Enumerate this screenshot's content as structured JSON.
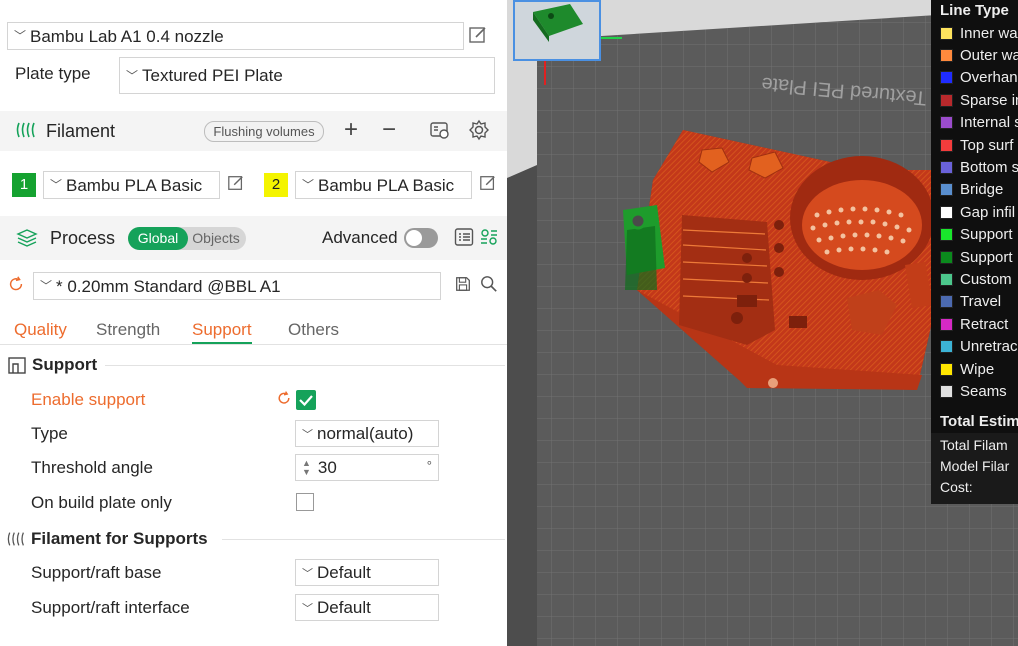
{
  "printer": {
    "name": "Bambu Lab A1 0.4 nozzle"
  },
  "plate": {
    "label": "Plate type",
    "value": "Textured PEI Plate"
  },
  "filament": {
    "title": "Filament",
    "flush_label": "Flushing volumes",
    "items": [
      {
        "index": "1",
        "name": "Bambu PLA Basic",
        "color": "#15a230"
      },
      {
        "index": "2",
        "name": "Bambu PLA Basic",
        "color": "#f4f400"
      }
    ]
  },
  "process": {
    "title": "Process",
    "toggle_global": "Global",
    "toggle_objects": "Objects",
    "advanced_label": "Advanced",
    "preset": "* 0.20mm Standard @BBL A1"
  },
  "tabs": [
    "Quality",
    "Strength",
    "Support",
    "Others"
  ],
  "support": {
    "section_title": "Support",
    "enable_label": "Enable support",
    "type_label": "Type",
    "type_value": "normal(auto)",
    "threshold_label": "Threshold angle",
    "threshold_value": "30",
    "threshold_unit": "°",
    "build_plate_label": "On build plate only"
  },
  "filament_supports": {
    "section_title": "Filament for Supports",
    "base_label": "Support/raft base",
    "base_value": "Default",
    "interface_label": "Support/raft interface",
    "interface_value": "Default"
  },
  "viewport": {
    "plate_text": "Textured PEI Plate"
  },
  "legend": {
    "title": "Line Type",
    "items": [
      {
        "label": "Inner wa",
        "color": "#ffe45e"
      },
      {
        "label": "Outer wa",
        "color": "#ff8a3d"
      },
      {
        "label": "Overhan",
        "color": "#1f2cff"
      },
      {
        "label": "Sparse in",
        "color": "#b8292c"
      },
      {
        "label": "Internal s",
        "color": "#9b4ccc"
      },
      {
        "label": "Top surf",
        "color": "#f33c3c"
      },
      {
        "label": "Bottom s",
        "color": "#6a62d9"
      },
      {
        "label": "Bridge",
        "color": "#5a8fcf"
      },
      {
        "label": "Gap infil",
        "color": "#ffffff"
      },
      {
        "label": "Support",
        "color": "#19e62c"
      },
      {
        "label": "Support",
        "color": "#0b8a1d"
      },
      {
        "label": "Custom",
        "color": "#4cc78c"
      },
      {
        "label": "Travel",
        "color": "#4c6ab0"
      },
      {
        "label": "Retract",
        "color": "#d629c5"
      },
      {
        "label": "Unretrac",
        "color": "#3cb3d6"
      },
      {
        "label": "Wipe",
        "color": "#ffe600"
      },
      {
        "label": "Seams",
        "color": "#e0e0e0"
      }
    ],
    "estimate_title": "Total Estim",
    "rows": [
      "Total Filam",
      "Model Filar",
      "Cost:"
    ]
  },
  "accent": "#15a25a",
  "highlight": "#ed6c2e"
}
